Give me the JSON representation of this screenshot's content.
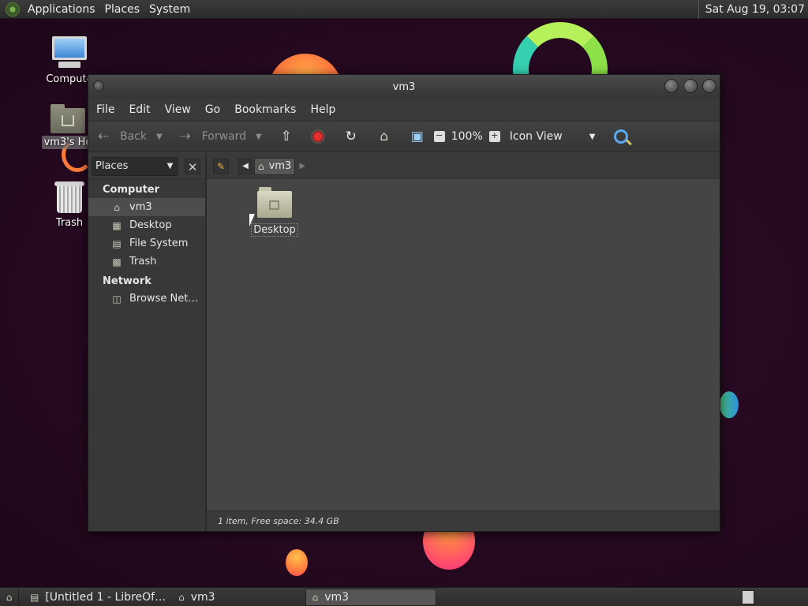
{
  "top_panel": {
    "menus": [
      "Applications",
      "Places",
      "System"
    ],
    "clock": "Sat Aug 19, 03:07"
  },
  "desktop_icons": [
    {
      "label": "Compute",
      "icon": "computer-icon"
    },
    {
      "label": "vm3's Ho",
      "icon": "home-folder-icon"
    },
    {
      "label": "Trash",
      "icon": "trash-icon"
    }
  ],
  "window": {
    "title": "vm3",
    "menubar": [
      "File",
      "Edit",
      "View",
      "Go",
      "Bookmarks",
      "Help"
    ],
    "toolbar": {
      "back": "Back",
      "forward": "Forward",
      "zoom": "100%",
      "view_mode": "Icon View"
    },
    "sidebar": {
      "selector": "Places",
      "sections": [
        {
          "title": "Computer",
          "items": [
            "vm3",
            "Desktop",
            "File System",
            "Trash"
          ]
        },
        {
          "title": "Network",
          "items": [
            "Browse Net…"
          ]
        }
      ]
    },
    "path": {
      "current": "vm3"
    },
    "files": [
      {
        "name": "Desktop",
        "icon": "folder-icon"
      }
    ],
    "status": "1 item, Free space: 34.4 GB"
  },
  "taskbar": {
    "tasks": [
      "[Untitled 1 - LibreOf…",
      "vm3",
      "vm3"
    ]
  }
}
